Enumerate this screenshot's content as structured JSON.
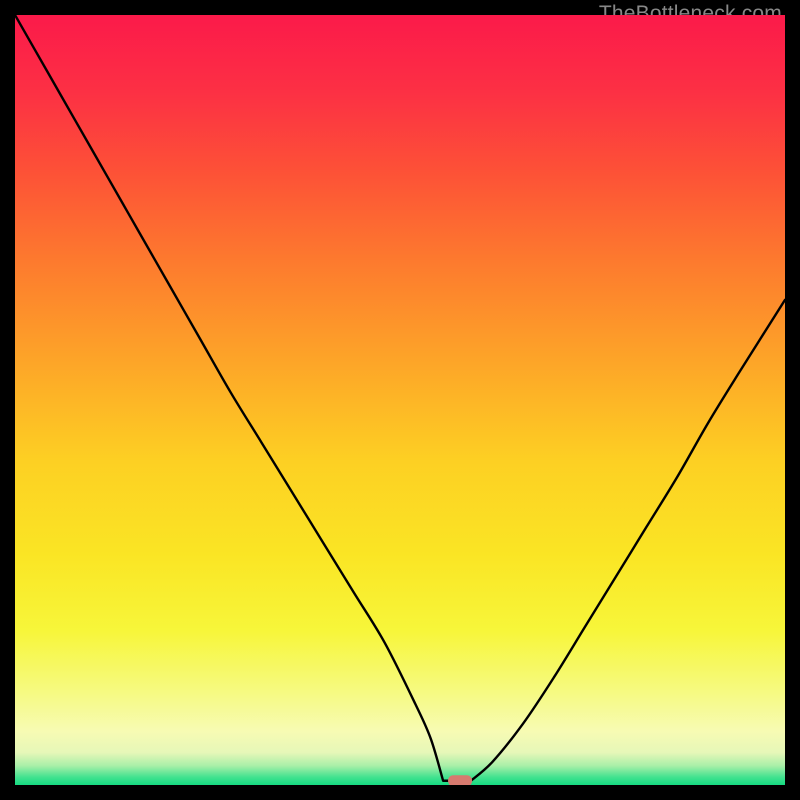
{
  "attribution": "TheBottleneck.com",
  "colors": {
    "frame": "#000000",
    "curve": "#000000",
    "marker_fill": "#d77a6f",
    "marker_stroke": "#b95a4f",
    "gradient_stops": [
      {
        "offset": 0.0,
        "color": "#fb1a4a"
      },
      {
        "offset": 0.1,
        "color": "#fc3044"
      },
      {
        "offset": 0.2,
        "color": "#fd5037"
      },
      {
        "offset": 0.32,
        "color": "#fd7a2e"
      },
      {
        "offset": 0.45,
        "color": "#fda528"
      },
      {
        "offset": 0.58,
        "color": "#fdd023"
      },
      {
        "offset": 0.7,
        "color": "#fae524"
      },
      {
        "offset": 0.8,
        "color": "#f7f63a"
      },
      {
        "offset": 0.88,
        "color": "#f6fa82"
      },
      {
        "offset": 0.93,
        "color": "#f7fbb3"
      },
      {
        "offset": 0.958,
        "color": "#e6f7b8"
      },
      {
        "offset": 0.975,
        "color": "#a9efa8"
      },
      {
        "offset": 0.99,
        "color": "#41e28f"
      },
      {
        "offset": 1.0,
        "color": "#16db82"
      }
    ]
  },
  "chart_data": {
    "type": "line",
    "title": "",
    "xlabel": "",
    "ylabel": "",
    "xlim": [
      0,
      100
    ],
    "ylim": [
      0,
      100
    ],
    "legend": false,
    "grid": false,
    "x": [
      0,
      4,
      8,
      12,
      16,
      20,
      24,
      28,
      32,
      36,
      40,
      44,
      48,
      52,
      54,
      56,
      57.5,
      59,
      62,
      66,
      70,
      74,
      78,
      82,
      86,
      90,
      94,
      100
    ],
    "y": [
      100,
      93,
      86,
      79,
      72,
      65,
      58,
      51,
      44.5,
      38,
      31.5,
      25,
      18.5,
      10.5,
      6,
      2.2,
      0.7,
      0.5,
      3,
      8,
      14,
      20.5,
      27,
      33.5,
      40,
      47,
      53.5,
      63
    ],
    "marker": {
      "x": 57.8,
      "y": 0.55
    },
    "flat_region": {
      "x0": 55.6,
      "x1": 59.2,
      "y": 0.55
    },
    "annotations": []
  }
}
